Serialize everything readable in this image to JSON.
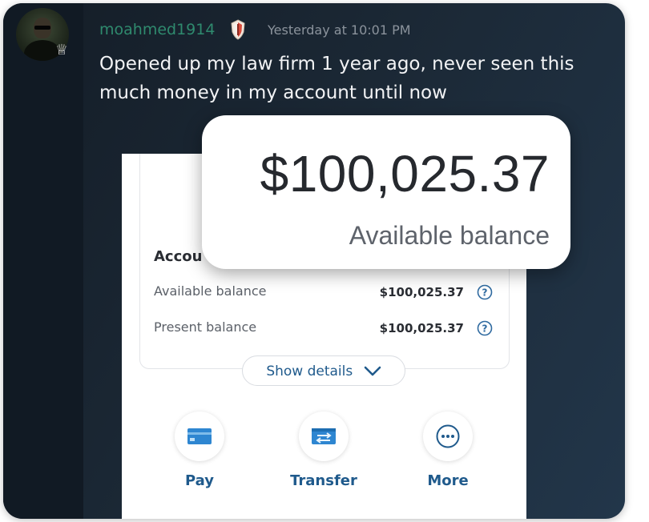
{
  "post": {
    "username": "moahmed1914",
    "timestamp": "Yesterday at 10:01 PM",
    "message": "Opened up my law firm 1 year ago, never seen this much money in my account until now"
  },
  "screenshot": {
    "zoom": {
      "amount": "$100,025.37",
      "label": "Available balance"
    },
    "account": {
      "title": "Accou",
      "rows": [
        {
          "label": "Available balance",
          "value": "$100,025.37"
        },
        {
          "label": "Present balance",
          "value": "$100,025.37"
        }
      ]
    },
    "show_details": "Show details",
    "actions": [
      {
        "label": "Pay",
        "icon": "credit-card-icon"
      },
      {
        "label": "Transfer",
        "icon": "transfer-card-icon"
      },
      {
        "label": "More",
        "icon": "more-dots-icon"
      }
    ]
  },
  "colors": {
    "username": "#2f8a6e",
    "bank_blue": "#1f5a8c",
    "background": "#1b2835"
  }
}
